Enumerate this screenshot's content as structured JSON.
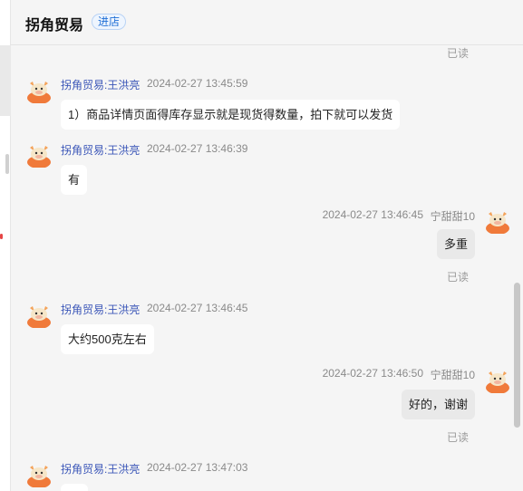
{
  "header": {
    "shop_name": "拐角贸易",
    "enter_shop_label": "进店"
  },
  "messages": [
    {
      "type": "read_only",
      "read_label": "已读"
    },
    {
      "sender": "拐角贸易:王洪亮",
      "time": "2024-02-27 13:45:59",
      "text": "1）商品详情页面得库存显示就是现货得数量，拍下就可以发货"
    },
    {
      "sender": "拐角贸易:王洪亮",
      "time": "2024-02-27 13:46:39",
      "text": "有"
    },
    {
      "self": true,
      "time": "2024-02-27 13:46:45",
      "sender": "宁甜甜10",
      "text": "多重",
      "read_label": "已读"
    },
    {
      "sender": "拐角贸易:王洪亮",
      "time": "2024-02-27 13:46:45",
      "text": "大约500克左右"
    },
    {
      "self": true,
      "time": "2024-02-27 13:46:50",
      "sender": "宁甜甜10",
      "text": "好的，谢谢",
      "read_label": "已读"
    },
    {
      "sender": "拐角贸易:王洪亮",
      "time": "2024-02-27 13:47:03",
      "text": ""
    }
  ],
  "colors": {
    "sender_name": "#3b56b8",
    "enter_button": "#1f6fd6",
    "avatar_orange": "#f07a3a"
  },
  "icons": {
    "avatar": "ox-mascot-avatar-icon"
  }
}
